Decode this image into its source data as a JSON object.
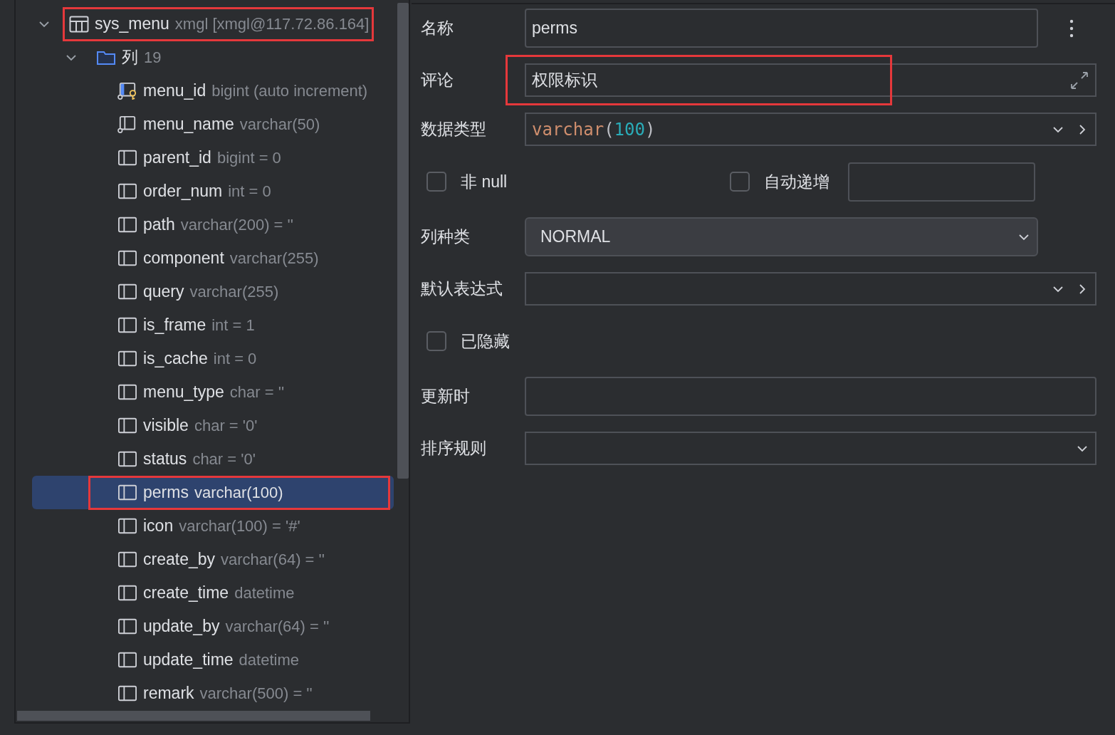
{
  "tree": [
    {
      "name": "sys_menu",
      "detail": "xmgl [xmgl@117.72.86.164]",
      "expanded": true,
      "annotated": true,
      "children": [
        {
          "name": "列",
          "count": "19",
          "expanded": true,
          "children": [
            {
              "name": "menu_id",
              "type": "bigint (auto increment)",
              "kind": "primary_key",
              "selected": false,
              "annotated": false
            },
            {
              "name": "menu_name",
              "type": "varchar(50)",
              "kind": "not_null",
              "selected": false,
              "annotated": false
            },
            {
              "name": "parent_id",
              "type": "bigint = 0",
              "kind": "plain",
              "selected": false,
              "annotated": false
            },
            {
              "name": "order_num",
              "type": "int = 0",
              "kind": "plain",
              "selected": false,
              "annotated": false
            },
            {
              "name": "path",
              "type": "varchar(200) = ''",
              "kind": "plain",
              "selected": false,
              "annotated": false
            },
            {
              "name": "component",
              "type": "varchar(255)",
              "kind": "plain",
              "selected": false,
              "annotated": false
            },
            {
              "name": "query",
              "type": "varchar(255)",
              "kind": "plain",
              "selected": false,
              "annotated": false
            },
            {
              "name": "is_frame",
              "type": "int = 1",
              "kind": "plain",
              "selected": false,
              "annotated": false
            },
            {
              "name": "is_cache",
              "type": "int = 0",
              "kind": "plain",
              "selected": false,
              "annotated": false
            },
            {
              "name": "menu_type",
              "type": "char = ''",
              "kind": "plain",
              "selected": false,
              "annotated": false
            },
            {
              "name": "visible",
              "type": "char = '0'",
              "kind": "plain",
              "selected": false,
              "annotated": false
            },
            {
              "name": "status",
              "type": "char = '0'",
              "kind": "plain",
              "selected": false,
              "annotated": false
            },
            {
              "name": "perms",
              "type": "varchar(100)",
              "kind": "plain",
              "selected": true,
              "annotated": true
            },
            {
              "name": "icon",
              "type": "varchar(100) = '#'",
              "kind": "plain",
              "selected": false,
              "annotated": false
            },
            {
              "name": "create_by",
              "type": "varchar(64) = ''",
              "kind": "plain",
              "selected": false,
              "annotated": false
            },
            {
              "name": "create_time",
              "type": "datetime",
              "kind": "plain",
              "selected": false,
              "annotated": false
            },
            {
              "name": "update_by",
              "type": "varchar(64) = ''",
              "kind": "plain",
              "selected": false,
              "annotated": false
            },
            {
              "name": "update_time",
              "type": "datetime",
              "kind": "plain",
              "selected": false,
              "annotated": false
            },
            {
              "name": "remark",
              "type": "varchar(500) = ''",
              "kind": "plain",
              "selected": false,
              "annotated": false
            }
          ]
        }
      ]
    }
  ],
  "form": {
    "name": {
      "label": "名称",
      "value": "perms"
    },
    "comment": {
      "label": "评论",
      "value": "权限标识",
      "annotated": true
    },
    "data_type": {
      "label": "数据类型",
      "type_name": "varchar",
      "open": "(",
      "length": "100",
      "close": ")"
    },
    "not_null": {
      "label": "非 null",
      "checked": false
    },
    "auto_increment": {
      "label": "自动递增",
      "checked": false
    },
    "column_kind": {
      "label": "列种类",
      "value": "NORMAL"
    },
    "default_expression": {
      "label": "默认表达式"
    },
    "hidden": {
      "label": "已隐藏",
      "checked": false
    },
    "on_update": {
      "label": "更新时"
    },
    "collation": {
      "label": "排序规则"
    }
  }
}
